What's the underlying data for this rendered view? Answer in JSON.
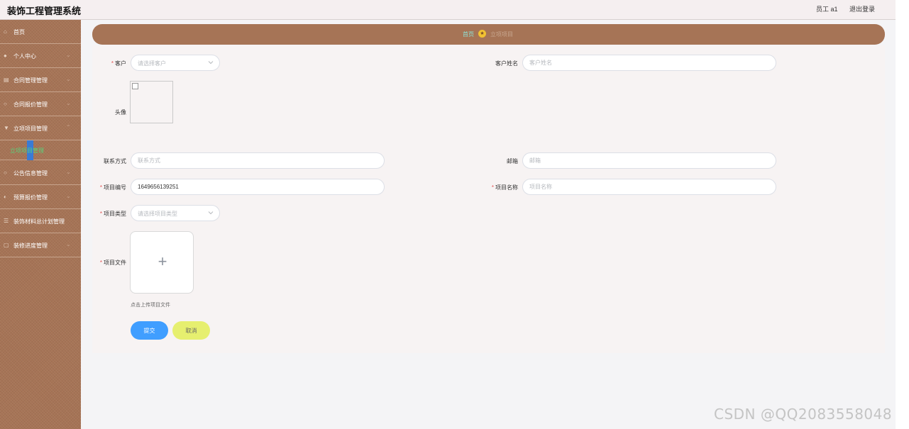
{
  "header": {
    "app_title": "装饰工程管理系统",
    "user_label": "员工 a1",
    "logout_label": "退出登录"
  },
  "sidebar": {
    "items": [
      {
        "label": "首页",
        "icon": "home-icon"
      },
      {
        "label": "个人中心",
        "icon": "user-icon"
      },
      {
        "label": "合同管理管理",
        "icon": "contract-icon"
      },
      {
        "label": "合同报价管理",
        "icon": "quote-icon"
      },
      {
        "label": "立项项目管理",
        "icon": "filter-icon"
      },
      {
        "label": "公告信息管理",
        "icon": "notice-icon"
      },
      {
        "label": "预算报价管理",
        "icon": "budget-icon"
      },
      {
        "label": "装饰材料总计划管理",
        "icon": "list-icon"
      },
      {
        "label": "装修进度管理",
        "icon": "progress-icon"
      }
    ],
    "submenu_active": "立项项目管理"
  },
  "breadcrumb": {
    "home": "首页",
    "current": "立项项目"
  },
  "form": {
    "customer": {
      "label": "客户",
      "placeholder": "请选择客户"
    },
    "customer_name": {
      "label": "客户姓名",
      "placeholder": "客户姓名"
    },
    "avatar": {
      "label": "头像"
    },
    "contact": {
      "label": "联系方式",
      "placeholder": "联系方式"
    },
    "email": {
      "label": "邮箱",
      "placeholder": "邮箱"
    },
    "project_no": {
      "label": "项目编号",
      "value": "1649656139251"
    },
    "project_name": {
      "label": "项目名称",
      "placeholder": "项目名称"
    },
    "project_type": {
      "label": "项目类型",
      "placeholder": "请选择项目类型"
    },
    "project_file": {
      "label": "项目文件",
      "upload_hint": "点击上传项目文件"
    },
    "submit_label": "提交",
    "cancel_label": "取消",
    "required_mark": "*"
  },
  "watermark": "CSDN @QQ2083558048",
  "colors": {
    "sidebar_bg": "#a67456",
    "primary": "#409eff",
    "cancel": "#e6ef6f",
    "active_submenu_text": "#5ad07a"
  }
}
